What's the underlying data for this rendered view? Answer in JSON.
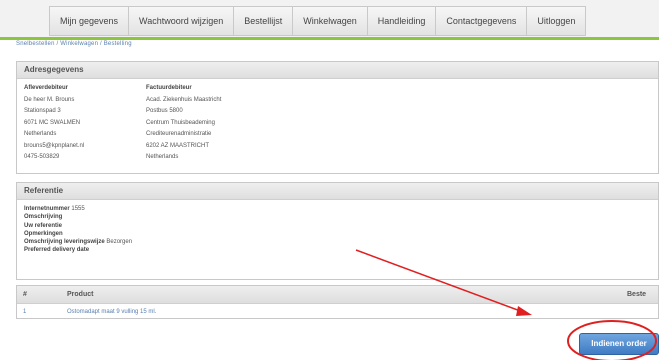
{
  "nav": {
    "items": [
      "Mijn gegevens",
      "Wachtwoord wijzigen",
      "Bestellijst",
      "Winkelwagen",
      "Handleiding",
      "Contactgegevens",
      "Uitloggen"
    ]
  },
  "breadcrumb": "Snelbestellen  /  Winkelwagen  /  Bestelling",
  "adres": {
    "title": "Adresgegevens",
    "afleveradres": {
      "header": "Afleverdebiteur",
      "lines": [
        "De heer M. Brouns",
        "Stationspad 3",
        "6071 MC  SWALMEN",
        "Netherlands",
        "brouns5@kpnplanet.nl",
        "0475-503829"
      ]
    },
    "factuuradres": {
      "header": "Factuurdebiteur",
      "lines": [
        "Acad. Ziekenhuis Maastricht",
        "Postbus 5800",
        "Centrum Thuisbeademing",
        "Crediteurenadministratie",
        "6202 AZ MAASTRICHT",
        "Netherlands"
      ]
    }
  },
  "referentie": {
    "title": "Referentie",
    "rows": [
      {
        "label": "Internetnummer",
        "value": "1555"
      },
      {
        "label": "Omschrijving",
        "value": ""
      },
      {
        "label": "Uw referentie",
        "value": ""
      },
      {
        "label": "Opmerkingen",
        "value": ""
      },
      {
        "label": "Omschrijving leveringswijze",
        "value": "Bezorgen"
      },
      {
        "label": "Preferred delivery date",
        "value": ""
      }
    ]
  },
  "table": {
    "headers": {
      "num": "#",
      "product": "Product",
      "besteld": "Beste"
    },
    "rows": [
      {
        "num": "1",
        "product": "Ostomadapt maat 9 vulling 15 ml."
      }
    ]
  },
  "submit": {
    "label": "Indienen order"
  },
  "colors": {
    "accent": "#8cc63f",
    "button": "#3f7cc4",
    "annotation": "#e02020"
  }
}
